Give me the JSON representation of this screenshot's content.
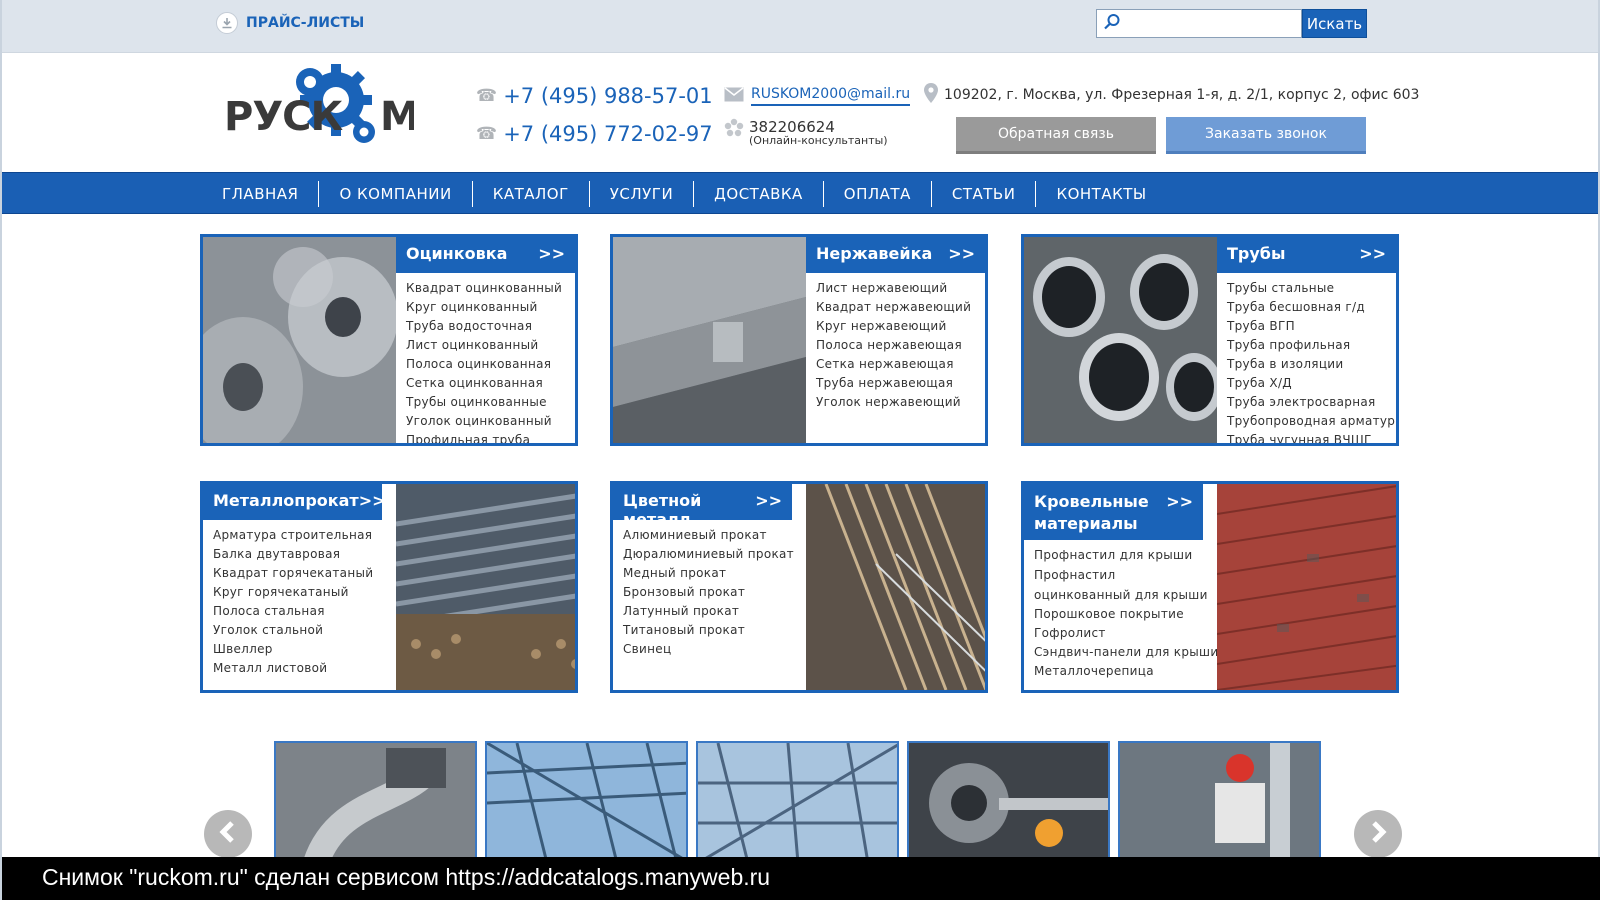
{
  "topbar": {
    "price_lists": "ПРАЙС-ЛИСТЫ",
    "search_placeholder": "",
    "search_button": "Искать"
  },
  "header": {
    "phone1": "+7 (495) 988-57-01",
    "phone2": "+7 (495) 772-02-97",
    "email": "RUSKOM2000@mail.ru",
    "icq_number": "382206624",
    "icq_note": "(Онлайн-консультанты)",
    "address": "109202, г. Москва, ул. Фрезерная 1-я, д. 2/1, корпус 2, офис 603",
    "feedback_button": "Обратная связь",
    "callback_button": "Заказать звонок"
  },
  "nav": [
    "ГЛАВНАЯ",
    "О КОМПАНИИ",
    "КАТАЛОГ",
    "УСЛУГИ",
    "ДОСТАВКА",
    "ОПЛАТА",
    "СТАТЬИ",
    "КОНТАКТЫ"
  ],
  "categories": [
    {
      "title": "Оцинковка",
      "arrow": ">>",
      "items": [
        "Квадрат оцинкованный",
        "Круг оцинкованный",
        "Труба водосточная",
        "Лист оцинкованный",
        "Полоса оцинкованная",
        "Сетка оцинкованная",
        "Трубы оцинкованные",
        "Уголок оцинкованный",
        "Профильная труба"
      ]
    },
    {
      "title": "Нержавейка",
      "arrow": ">>",
      "items": [
        "Лист нержавеющий",
        "Квадрат нержавеющий",
        "Круг нержавеющий",
        "Полоса нержавеющая",
        "Сетка нержавеющая",
        "Труба нержавеющая",
        "Уголок нержавеющий"
      ]
    },
    {
      "title": "Трубы",
      "arrow": ">>",
      "items": [
        "Трубы стальные",
        "Труба бесшовная г/д",
        "Труба ВГП",
        "Труба профильная",
        "Труба в изоляции",
        "Труба Х/Д",
        "Труба электросварная",
        "Трубопроводная арматура",
        "Труба чугунная ВЧШГ"
      ]
    },
    {
      "title": "Металлопрокат",
      "arrow": ">>",
      "items": [
        "Арматура строительная",
        "Балка двутавровая",
        "Квадрат горячекатаный",
        "Круг горячекатаный",
        "Полоса стальная",
        "Уголок стальной",
        "Швеллер",
        "Металл листовой"
      ]
    },
    {
      "title": "Цветной металл",
      "arrow": ">>",
      "items": [
        "Алюминиевый прокат",
        "Дюралюминиевый прокат",
        "Медный прокат",
        "Бронзовый прокат",
        "Латунный прокат",
        "Титановый прокат",
        "Свинец"
      ]
    },
    {
      "title": "Кровельные материалы",
      "arrow": ">>",
      "items": [
        "Профнастил для крыши",
        "Профнастил оцинкованный для крыши",
        "Порошковое покрытие",
        "Гофролист",
        "Сэндвич-панели для крыши",
        "Металлочерепица"
      ]
    }
  ],
  "footer_strip": "Снимок \"ruckom.ru\" сделан сервисом https://addcatalogs.manyweb.ru",
  "colors": {
    "brand_blue": "#1a63b8",
    "nav_blue": "#1a5fb4",
    "topbar_bg": "#dde4ec"
  },
  "logo_text": "РУСКОМ"
}
